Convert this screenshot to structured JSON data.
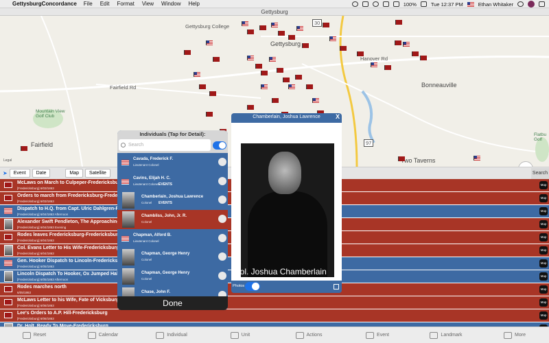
{
  "menubar": {
    "app": "GettysburgConcordance",
    "items": [
      "File",
      "Edit",
      "Format",
      "View",
      "Window",
      "Help"
    ],
    "battery": "100%",
    "clock": "Tue 12:37 PM",
    "user": "Ethan Whitaker"
  },
  "window": {
    "title": "Gettysburg"
  },
  "map": {
    "labels": {
      "gettysburg_college": "Gettysburg College",
      "gettysburg": "Gettysburg",
      "hanover_rd": "Hanover Rd",
      "fairfield_rd": "Fairfield Rd",
      "bonneauville": "Bonneauville",
      "mountain_view": "Mountain View Golf Club",
      "fairfield": "Fairfield",
      "two_taverns": "Two Taverns",
      "flatbush": "Flatbu Golf",
      "route30": "30",
      "route97": "97",
      "legal": "Legal"
    },
    "btn3d": "3D"
  },
  "controlbar": {
    "event": "Event",
    "date": "Date",
    "map": "Map",
    "satellite": "Satellite",
    "search": "Search"
  },
  "events": [
    {
      "title": "McLaws on March to Culpeper-Fredericksburg",
      "sub": "[Fredericksburg] 6/03/1863",
      "color": "red",
      "icon": "rf"
    },
    {
      "title": "Orders to march from Fredericksburg-Fredericksburg",
      "sub": "[Fredericksburg] 6/03/1863",
      "color": "red",
      "icon": "rf"
    },
    {
      "title": "Dispatch to H.Q. from Capt. Ulric Dahlgren-Fredericksburg",
      "sub": "[Fredericksburg] 6/04/1863 Afternoon",
      "color": "blue",
      "icon": "us"
    },
    {
      "title": "Alexander Swift Pendleton, The Approaching Campaign-Fredericksburg",
      "sub": "[Fredericksburg] 6/04/1863 Evening",
      "color": "red",
      "icon": "port"
    },
    {
      "title": "Rodes leaves Fredericksburg-Fredericksburg",
      "sub": "[Fredericksburg] 6/04/1863",
      "color": "red",
      "icon": "rf"
    },
    {
      "title": "Col. Evans Letter to His Wife-Fredericksburg",
      "sub": "[Fredericksburg] 6/04/1863",
      "color": "red",
      "icon": "port"
    },
    {
      "title": "Gen. Hooker Dispatch to Lincoln-Fredericksburg",
      "sub": "[Fredericksburg] 6/05/1863",
      "color": "blue",
      "icon": "us"
    },
    {
      "title": "Lincoln Dispatch To Hooker, Ox Jumped Half Over the Fence-Fredericksburg",
      "sub": "[Fredericksburg] 6/05/1863 Afternoon",
      "color": "blue",
      "icon": "port"
    },
    {
      "title": "Rodes marches north",
      "sub": "6/05/1863",
      "color": "red",
      "icon": "rf"
    },
    {
      "title": "McLaws Letter to his Wife, Fate of Vicksburg-Fredericksburg",
      "sub": "[Fredericksburg] 6/06/1863",
      "color": "red",
      "icon": "rf"
    },
    {
      "title": "Lee's Orders to A.P. Hill-Fredericksburg",
      "sub": "[Fredericksburg] 6/06/1863",
      "color": "red",
      "icon": "rf"
    },
    {
      "title": "Dr. Holt, Ready To Move-Fredericksburg",
      "sub": "",
      "color": "blue",
      "icon": "port"
    }
  ],
  "map_button": "Map",
  "tabs": [
    "Reset",
    "Calendar",
    "Individual",
    "Unit",
    "Actions",
    "Event",
    "Landmark",
    "More"
  ],
  "individuals": {
    "header": "Individuals (Tap for Detail):",
    "search_placeholder": "Search",
    "done": "Done",
    "rows": [
      {
        "name": "Cavada, Frederick F.",
        "rank": "Lieutenant Colonel",
        "events": "",
        "icon": "us",
        "red": false
      },
      {
        "name": "Cavins, Elijah H. C.",
        "rank": "Lieutenant Colonel",
        "events": "EVENTS",
        "icon": "us",
        "red": false
      },
      {
        "name": "Chamberlain, Joshua Lawrence",
        "rank": "Colonel",
        "events": "EVENTS",
        "icon": "port",
        "red": false
      },
      {
        "name": "Chambliss, John, Jr. R.",
        "rank": "Colonel",
        "events": "",
        "icon": "port",
        "red": true
      },
      {
        "name": "Chapman, Alford B.",
        "rank": "Lieutenant Colonel",
        "events": "",
        "icon": "us",
        "red": false
      },
      {
        "name": "Chapman, George Henry",
        "rank": "Colonel",
        "events": "",
        "icon": "port",
        "red": false
      },
      {
        "name": "Chapman, George Henry",
        "rank": "Colonel",
        "events": "",
        "icon": "port",
        "red": false
      },
      {
        "name": "Chase, John F.",
        "rank": "",
        "events": "",
        "icon": "port",
        "red": false
      }
    ]
  },
  "detail": {
    "title": "Chamberlain, Joshua Lawrence",
    "close": "X",
    "caption": "Col. Joshua Chamberlain",
    "photos_label": "Photos"
  }
}
